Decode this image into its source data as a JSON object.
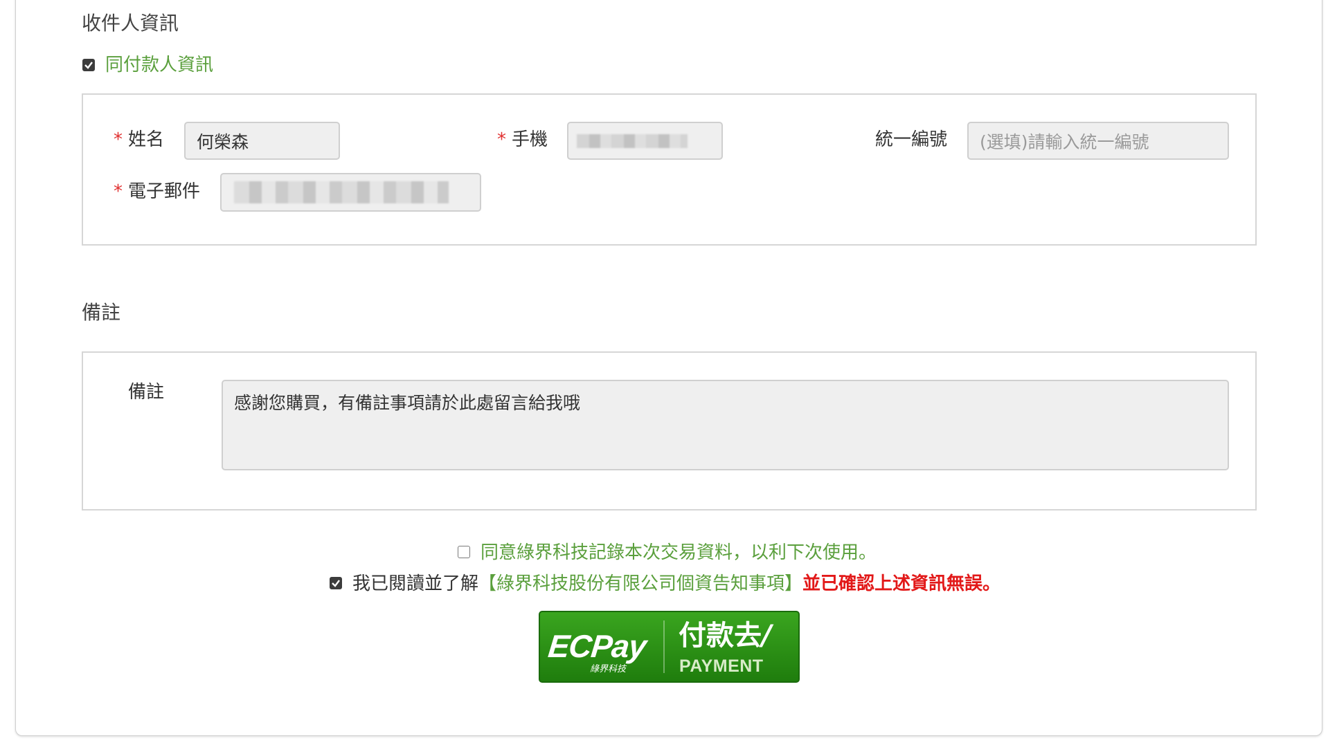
{
  "recipient": {
    "section_title": "收件人資訊",
    "same_as_payer": {
      "label": "同付款人資訊",
      "checked": true
    },
    "fields": {
      "name": {
        "label": "姓名",
        "required": true,
        "value": "何榮森"
      },
      "phone": {
        "label": "手機",
        "required": true,
        "value": ""
      },
      "tax_id": {
        "label": "統一編號",
        "required": false,
        "placeholder": "(選填)請輸入統一編號"
      },
      "email": {
        "label": "電子郵件",
        "required": true,
        "value": ""
      }
    }
  },
  "remarks": {
    "section_title": "備註",
    "label": "備註",
    "value": "感謝您購買，有備註事項請於此處留言給我哦"
  },
  "consent": {
    "record_transaction": {
      "label": "同意綠界科技記錄本次交易資料，以利下次使用。",
      "checked": false
    },
    "privacy": {
      "prefix": "我已閱讀並了解",
      "link": "【綠界科技股份有限公司個資告知事項】",
      "suffix": "並已確認上述資訊無誤。",
      "checked": true
    }
  },
  "pay_button": {
    "logo": "ECPay",
    "logo_sub": "綠界科技",
    "main": "付款去",
    "sub": "PAYMENT"
  },
  "colors": {
    "accent_green": "#5a9f3c",
    "required_red": "#e03030",
    "warning_red": "#e21818",
    "button_green": "#2a8f17"
  }
}
